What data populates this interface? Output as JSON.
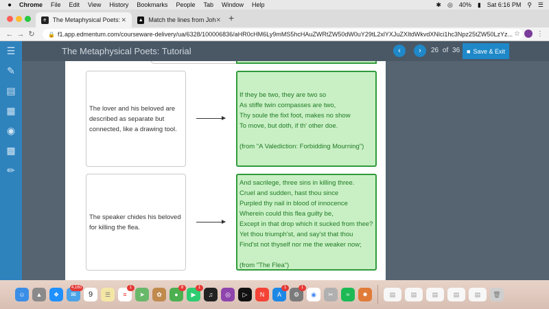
{
  "menubar": {
    "apple_icon": "apple-icon",
    "app_name": "Chrome",
    "items": [
      "File",
      "Edit",
      "View",
      "History",
      "Bookmarks",
      "People",
      "Tab",
      "Window",
      "Help"
    ],
    "battery": "40%",
    "clock": "Sat 6:16 PM"
  },
  "tabs": [
    {
      "title": "The Metaphysical Poets: Tutori",
      "icon": "edmentum-favicon",
      "active": true
    },
    {
      "title": "Match the lines from John Don",
      "icon": "brainly-favicon",
      "active": false
    }
  ],
  "newtab_label": "+",
  "address": {
    "url": "f1.app.edmentum.com/courseware-delivery/ua/6328/100006836/aHR0cHM6Ly9mMS5hcHAuZWRtZW50dW0uY29tL2xlYXJuZXItdWkvdXNlci1hc3Npz25tZW50LzYz..."
  },
  "header": {
    "title": "The Metaphysical Poets: Tutorial",
    "current_page": "26",
    "of_label": "of",
    "total_pages": "36",
    "save_label": "Save & Exit"
  },
  "matches": [
    {
      "prompt": "The lover and his beloved are described as separate but connected, like a drawing tool.",
      "lines": [
        "If they be two, they are two so",
        "As stiffe twin compasses are two,",
        "Thy soule the fixt foot, makes no show",
        "To move, but doth, if th' other doe."
      ],
      "source": "(from \"A Valediction: Forbidding Mourning\")"
    },
    {
      "prompt": "The speaker chides his beloved for killing the flea.",
      "lines": [
        "And sacrilege, three sins in killing three.",
        "Cruel and sudden, hast thou since",
        "Purpled thy nail in blood of innocence",
        "Wherein could this flea guilty be,",
        "Except in that drop which it sucked from thee?",
        "Yet thou triumph'st, and say'st that thou",
        "Find'st not thyself nor me the weaker now;"
      ],
      "source": "(from \"The Flea\")"
    }
  ],
  "dock": {
    "mail_badge": "4,160",
    "calendar_day": "9",
    "reminders_badge": "1",
    "messages_badge": "8",
    "facetime_badge": "1",
    "appstore_badge": "1",
    "settings_badge": "1"
  },
  "colors": {
    "rail": "#2f83bd",
    "header": "#4a5866",
    "accent": "#1e88c8",
    "match_fill": "#c9f0c4",
    "match_border": "#2f9a3a",
    "match_text": "#1f7a26"
  }
}
